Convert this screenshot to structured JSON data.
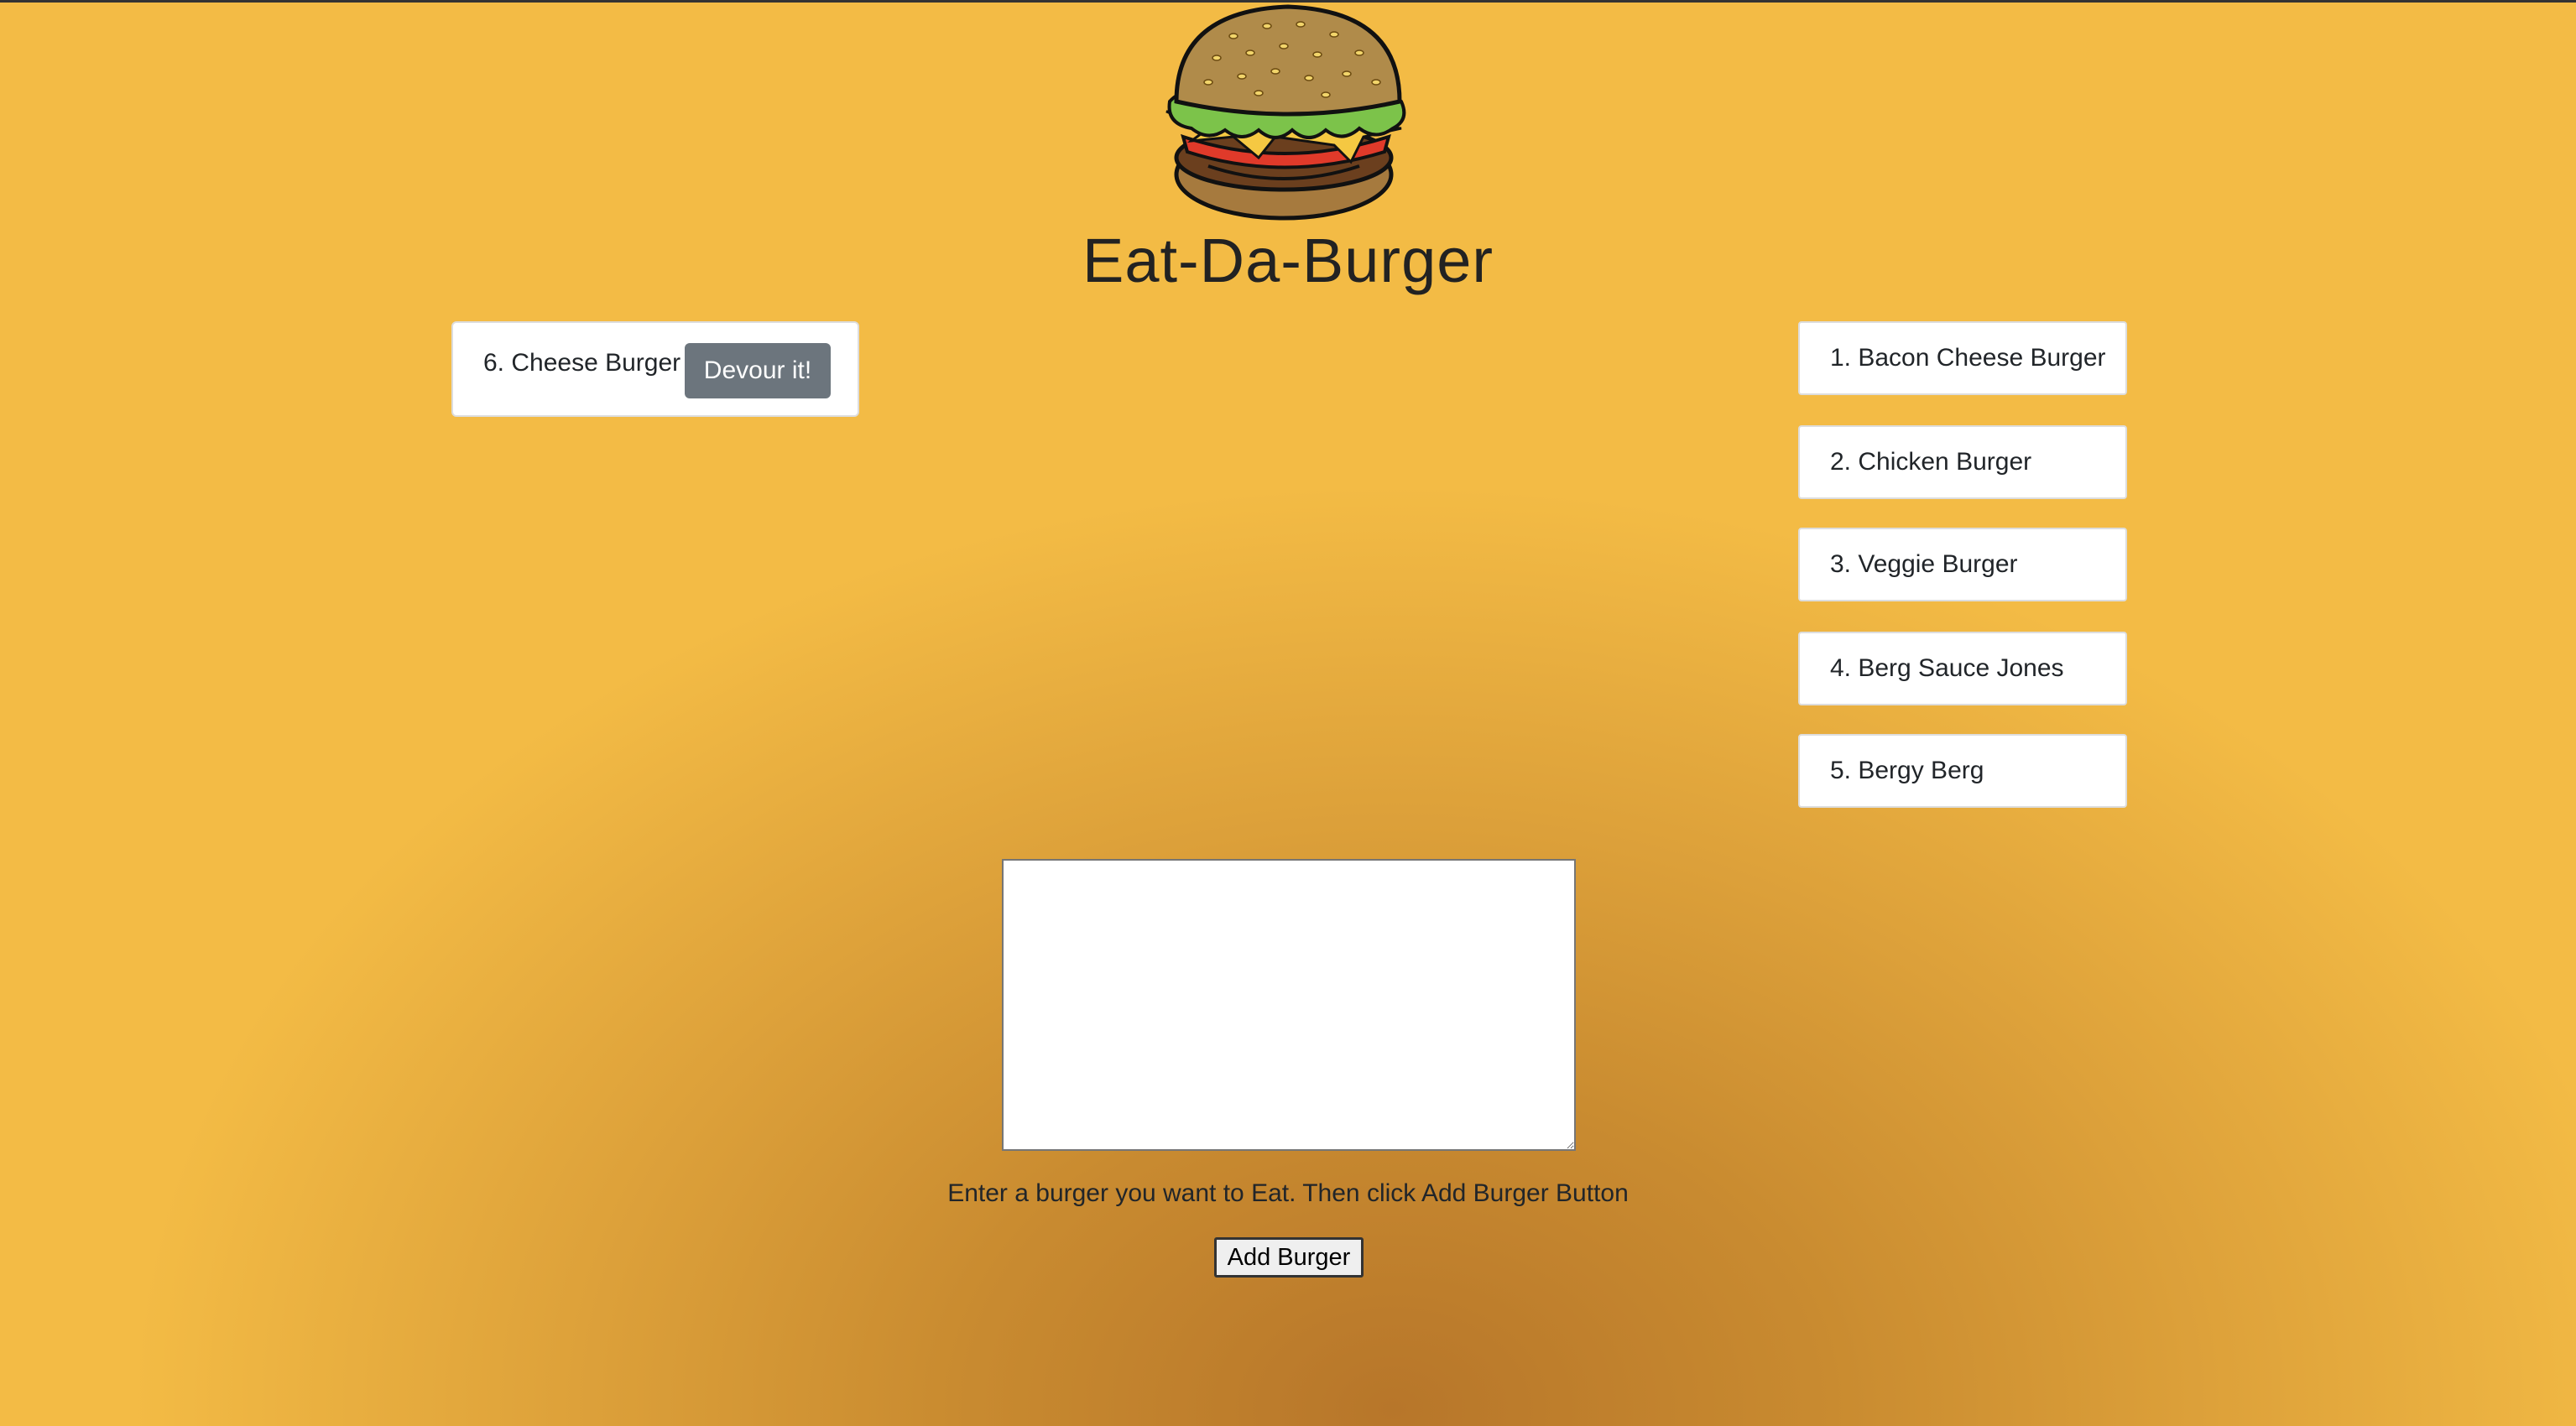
{
  "header": {
    "logo_icon": "burger-logo-icon",
    "title": "Eat-Da-Burger"
  },
  "uneaten": {
    "items": [
      {
        "label": "6. Cheese Burger",
        "button_label": "Devour it!"
      }
    ]
  },
  "eaten": {
    "items": [
      {
        "label": "1. Bacon Cheese Burger"
      },
      {
        "label": "2. Chicken Burger"
      },
      {
        "label": "3. Veggie Burger"
      },
      {
        "label": "4. Berg Sauce Jones"
      },
      {
        "label": "5. Bergy Berg"
      }
    ]
  },
  "form": {
    "input_value": "",
    "instructions": "Enter a burger you want to Eat. Then click Add Burger Button",
    "submit_label": "Add Burger"
  },
  "colors": {
    "background_center": "#b7762a",
    "background_edge": "#f3bb45",
    "devour_button": "#6c757d"
  }
}
